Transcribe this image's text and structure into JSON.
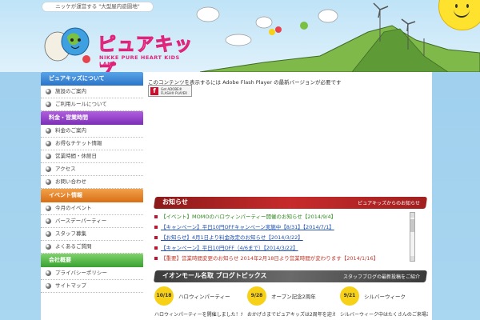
{
  "header": {
    "tagline": "ニッケが運営する \"大型屋内遊園地\"",
    "logo_text": "ピュアキッズ",
    "logo_sub": "NIKKE PURE HEART KIDS LAND"
  },
  "sidebar": {
    "groups": [
      {
        "title": "ピュアキッズについて",
        "color": "blue",
        "items": [
          "施設のご案内",
          "ご利用ルールについて"
        ]
      },
      {
        "title": "料金・営業時間",
        "color": "purple",
        "items": [
          "料金のご案内",
          "お得なチケット情報",
          "営業時間・休館日",
          "アクセス",
          "お問い合わせ"
        ]
      },
      {
        "title": "イベント情報",
        "color": "orange",
        "items": [
          "今月のイベント",
          "バースデーパーティー",
          "スタッフ募集",
          "よくあるご質問"
        ]
      },
      {
        "title": "会社概要",
        "color": "green",
        "items": [
          "プライバシーポリシー",
          "サイトマップ"
        ]
      }
    ]
  },
  "main": {
    "flash_message": "このコンテンツを表示するには Adobe Flash Player の最新バージョンが必要です",
    "flash_badge_line1": "Get ADOBE®",
    "flash_badge_line2": "FLASH® PLAYER",
    "flash_badge_icon": "f",
    "news": {
      "title": "お知らせ",
      "subtitle": "ピュアキッズからのお知らせ",
      "items": [
        {
          "text": "【イベント】MOMOのハロウィンパーティー開催のお知らせ【2014/9/4】",
          "style": "green"
        },
        {
          "text": "【キャンペーン】平日10円OFFキャンペーン実施中【8/31】【2014/7/1】",
          "style": "blue"
        },
        {
          "text": "【お知らせ】4月1日より料金改定のお知らせ【2014/3/22】",
          "style": "blue"
        },
        {
          "text": "【キャンペーン】平日10円OFF（4/6まで）【2014/3/22】",
          "style": "blue"
        },
        {
          "text": "【重要】営業時間変更のお知らせ 2014年2月18日より営業時間が変わります【2014/1/16】",
          "style": "red"
        }
      ]
    },
    "blog": {
      "title": "イオンモール名取 ブログトピックス",
      "subtitle": "スタッフブログの最新投稿をご紹介",
      "posts": [
        {
          "date": "10/18",
          "title": "ハロウィンパーティー",
          "text": "ハロウィンパーティーを開催しました！たくさんの"
        },
        {
          "date": "9/28",
          "title": "オープン記念2周年",
          "text": "おかげさまでピュアキッズは2周年を迎えました"
        },
        {
          "date": "9/21",
          "title": "シルバーウィーク",
          "text": "シルバーウィーク中はたくさんのご来場ありがとう"
        }
      ]
    }
  }
}
